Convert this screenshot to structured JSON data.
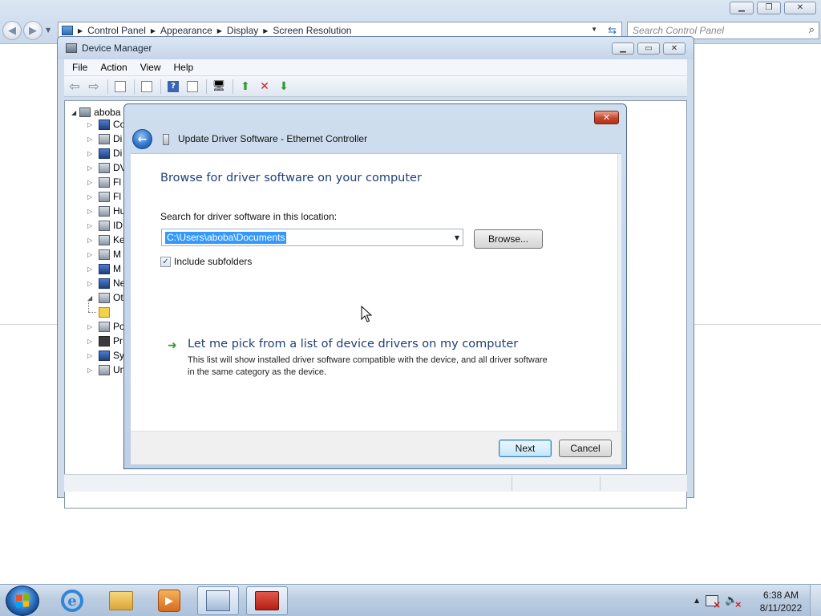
{
  "control_panel": {
    "breadcrumbs": [
      "Control Panel",
      "Appearance",
      "Display",
      "Screen Resolution"
    ],
    "search_placeholder": "Search Control Panel"
  },
  "device_manager": {
    "title": "Device Manager",
    "menu": [
      "File",
      "Action",
      "View",
      "Help"
    ],
    "tree": {
      "root_label": "aboba",
      "items": [
        {
          "label": "Co",
          "icon": "computer-icon"
        },
        {
          "label": "Di",
          "icon": "disk-drive-icon"
        },
        {
          "label": "Di",
          "icon": "display-adapter-icon"
        },
        {
          "label": "DV",
          "icon": "dvd-drive-icon"
        },
        {
          "label": "Fl",
          "icon": "floppy-controller-icon"
        },
        {
          "label": "Fl",
          "icon": "floppy-drive-icon"
        },
        {
          "label": "Hu",
          "icon": "hid-icon"
        },
        {
          "label": "ID",
          "icon": "ide-controller-icon"
        },
        {
          "label": "Ke",
          "icon": "keyboard-icon"
        },
        {
          "label": "M",
          "icon": "mouse-icon"
        },
        {
          "label": "M",
          "icon": "monitor-icon"
        },
        {
          "label": "Ne",
          "icon": "network-adapter-icon"
        },
        {
          "label": "Ot",
          "icon": "other-devices-icon"
        },
        {
          "label": "Po",
          "icon": "ports-icon"
        },
        {
          "label": "Pr",
          "icon": "processor-icon"
        },
        {
          "label": "Sy",
          "icon": "system-devices-icon"
        },
        {
          "label": "Un",
          "icon": "usb-controller-icon"
        }
      ]
    }
  },
  "dialog": {
    "title": "Update Driver Software - Ethernet Controller",
    "close_glyph": "✕",
    "heading": "Browse for driver software on your computer",
    "search_label": "Search for driver software in this location:",
    "path_value": "C:\\Users\\aboba\\Documents",
    "browse_label": "Browse...",
    "include_subfolders_label": "Include subfolders",
    "include_subfolders_checked": true,
    "pick_title": "Let me pick from a list of device drivers on my computer",
    "pick_description": "This list will show installed driver software compatible with the device, and all driver software in the same category as the device.",
    "next_label": "Next",
    "cancel_label": "Cancel"
  },
  "taskbar": {
    "pinned": [
      "start-button",
      "internet-explorer",
      "windows-explorer",
      "media-player",
      "control-panel",
      "device-manager-toolbox"
    ],
    "clock_time": "6:38 AM",
    "clock_date": "8/11/2022"
  },
  "colors": {
    "heading_blue": "#1e3f78",
    "selection_blue": "#3399ff",
    "close_red": "#c9462b",
    "arrow_green": "#2f9b2f"
  }
}
